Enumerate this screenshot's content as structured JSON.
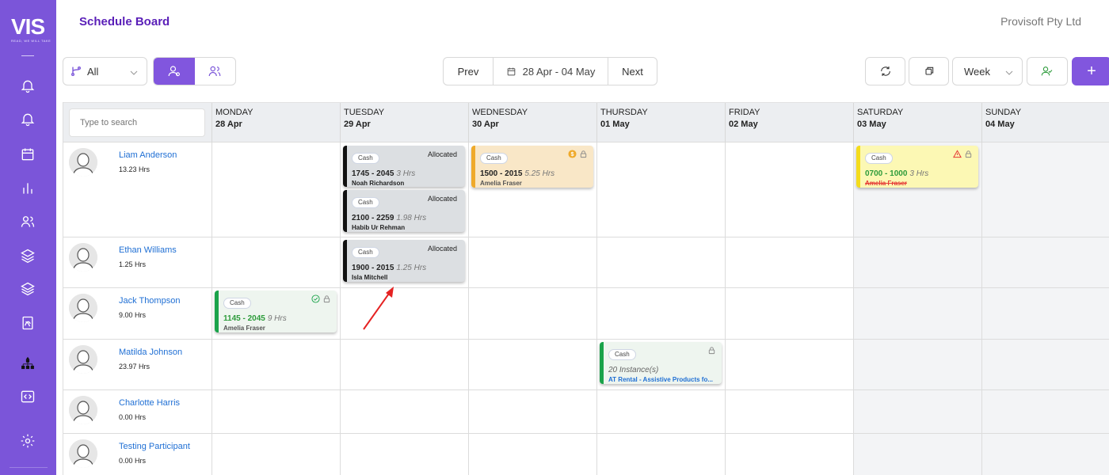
{
  "app": {
    "logo_text": "VIS",
    "logo_subtext": "READ, WE WILL TAKE",
    "page_title": "Schedule Board",
    "company": "Provisoft Pty Ltd"
  },
  "sidebar": {
    "items": [
      {
        "icon": "bell-icon"
      },
      {
        "icon": "bell-outline-icon"
      },
      {
        "icon": "calendar-icon"
      },
      {
        "icon": "bar-chart-icon"
      },
      {
        "icon": "users-icon"
      },
      {
        "icon": "layers-icon"
      },
      {
        "icon": "layers-alt-icon"
      },
      {
        "icon": "document-icon"
      },
      {
        "icon": "org-chart-icon"
      },
      {
        "icon": "code-icon"
      },
      {
        "icon": "gear-icon"
      }
    ]
  },
  "toolbar": {
    "filter_label": "All",
    "prev_label": "Prev",
    "date_range": "28 Apr - 04 May",
    "next_label": "Next",
    "view_label": "Week",
    "add_label": "+",
    "accent_color": "#7b55d9"
  },
  "search": {
    "placeholder": "Type to search"
  },
  "days": [
    {
      "name": "MONDAY",
      "date": "28 Apr"
    },
    {
      "name": "TUESDAY",
      "date": "29 Apr"
    },
    {
      "name": "WEDNESDAY",
      "date": "30 Apr"
    },
    {
      "name": "THURSDAY",
      "date": "01 May"
    },
    {
      "name": "FRIDAY",
      "date": "02 May"
    },
    {
      "name": "SATURDAY",
      "date": "03 May"
    },
    {
      "name": "SUNDAY",
      "date": "04 May"
    }
  ],
  "people": [
    {
      "name": "Liam Anderson",
      "hours": "13.23 Hrs"
    },
    {
      "name": "Ethan Williams",
      "hours": "1.25 Hrs"
    },
    {
      "name": "Jack Thompson",
      "hours": "9.00 Hrs"
    },
    {
      "name": "Matilda Johnson",
      "hours": "23.97 Hrs"
    },
    {
      "name": "Charlotte Harris",
      "hours": "0.00 Hrs"
    },
    {
      "name": "Testing Participant",
      "hours": "0.00 Hrs"
    }
  ],
  "shifts": {
    "liam_tue_1": {
      "tag": "Cash",
      "status": "Allocated",
      "time": "1745 - 2045",
      "duration": "3 Hrs",
      "person": "Noah Richardson"
    },
    "liam_tue_2": {
      "tag": "Cash",
      "status": "Allocated",
      "time": "2100 - 2259",
      "duration": "1.98 Hrs",
      "person": "Habib Ur Rehman"
    },
    "liam_wed": {
      "tag": "Cash",
      "time": "1500 - 2015",
      "duration": "5.25 Hrs",
      "person": "Amelia Fraser"
    },
    "liam_sat": {
      "tag": "Cash",
      "time": "0700 - 1000",
      "duration": "3 Hrs",
      "person": "Amelia Fraser"
    },
    "ethan_tue": {
      "tag": "Cash",
      "status": "Allocated",
      "time": "1900 - 2015",
      "duration": "1.25 Hrs",
      "person": "Isla Mitchell"
    },
    "jack_mon": {
      "tag": "Cash",
      "time": "1145 - 2045",
      "duration": "9 Hrs",
      "person": "Amelia Fraser"
    },
    "matilda_thu": {
      "tag": "Cash",
      "instances": "20 Instance(s)",
      "service": "AT Rental - Assistive Products fo..."
    }
  },
  "colors": {
    "allocated": "#111111",
    "pending": "#efaa2b",
    "warning": "#f4dc1c",
    "confirmed": "#1aa34a"
  }
}
